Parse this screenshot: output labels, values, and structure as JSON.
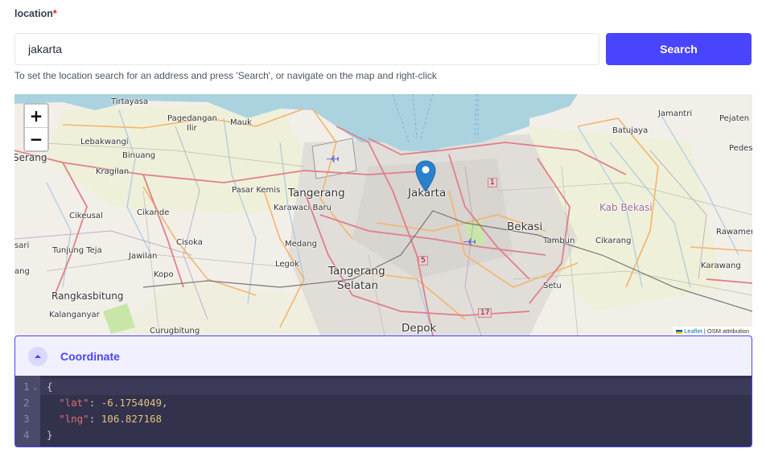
{
  "form": {
    "label": "location",
    "required_mark": "*",
    "search_value": "jakarta",
    "search_placeholder": "",
    "search_button": "Search",
    "hint": "To set the location search for an address and press 'Search', or navigate on the map and right-click",
    "accent_color": "#4945ff"
  },
  "map": {
    "zoom_in": "+",
    "zoom_out": "−",
    "marker_icon": "map-pin-icon",
    "attribution_leaflet": "Leaflet",
    "attribution_sep": " | ",
    "attribution_osm": "OSM attribution",
    "labels": {
      "tirtayasa": "Tirtayasa",
      "pagedangan": "Pagedangan",
      "ilir": "Ilir",
      "mauk": "Mauk",
      "lebakwangi": "Lebakwangi",
      "binuang": "Binuang",
      "serang": "Serang",
      "kragilan": "Kragilan",
      "pasar_kemis": "Pasar Kemis",
      "tangerang": "Tangerang",
      "karawaci_baru": "Karawaci Baru",
      "jakarta": "Jakarta",
      "cikeusal": "Cikeusal",
      "cikande": "Cikande",
      "sari": "sari",
      "tunjung_teja": "Tunjung Teja",
      "cisoka": "Cisoka",
      "jawilan": "Jawilan",
      "medang": "Medang",
      "legok": "Legok",
      "ang": "ang",
      "kopo": "Kopo",
      "tangerang_selatan_1": "Tangerang",
      "tangerang_selatan_2": "Selatan",
      "rangkasbitung": "Rangkasbitung",
      "kalanganyar": "Kalanganyar",
      "curugbitung": "Curugbitung",
      "depok": "Depok",
      "jamantri": "Jamantri",
      "pejaten": "Pejaten",
      "batujaya": "Batujaya",
      "pedes": "Pedes",
      "kab_bekasi": "Kab Bekasi",
      "bekasi": "Bekasi",
      "tambun": "Tambun",
      "cikarang": "Cikarang",
      "rawamer": "Rawamer",
      "karawang": "Karawang",
      "setu": "Setu",
      "shield_1": "1",
      "shield_5": "5",
      "shield_17": "17"
    }
  },
  "coordinate": {
    "title": "Coordinate",
    "line_numbers": [
      "1",
      "2",
      "3",
      "4"
    ],
    "lat_key": "\"lat\"",
    "lat_value": "-6.1754049",
    "lng_key": "\"lng\"",
    "lng_value": "106.827168",
    "open_brace": "{",
    "close_brace": "}"
  }
}
